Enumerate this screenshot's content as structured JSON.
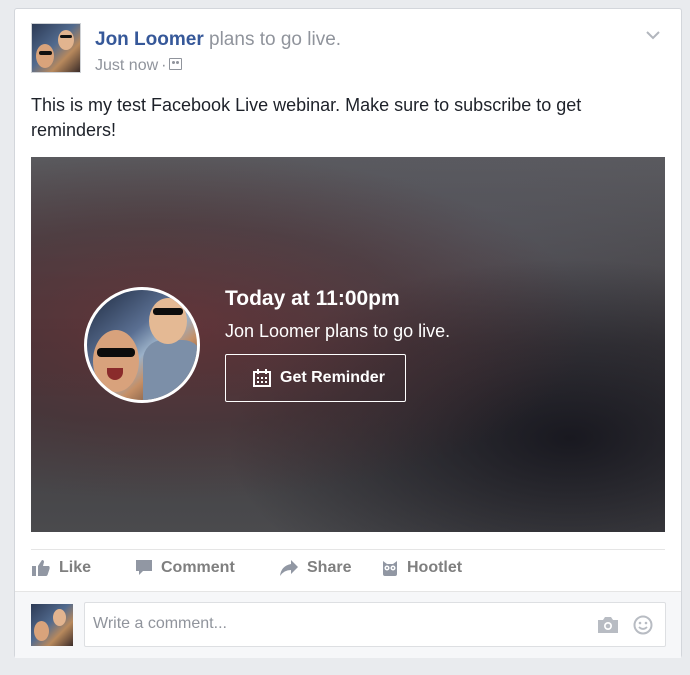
{
  "post": {
    "author": "Jon Loomer",
    "action": "plans to go live.",
    "timestamp": "Just now",
    "separator": "·",
    "audience_icon": "custom-audience-icon",
    "text": "This is my test Facebook Live webinar. Make sure to subscribe to get reminders!"
  },
  "live": {
    "title": "Today at 11:00pm",
    "subtitle": "Jon Loomer plans to go live.",
    "button_label": "Get Reminder"
  },
  "actions": [
    {
      "label": "Like",
      "icon": "thumbs-up-icon"
    },
    {
      "label": "Comment",
      "icon": "speech-bubble-icon"
    },
    {
      "label": "Share",
      "icon": "share-arrow-icon"
    },
    {
      "label": "Hootlet",
      "icon": "owl-icon"
    }
  ],
  "comment": {
    "placeholder": "Write a comment..."
  },
  "colors": {
    "link": "#365899",
    "muted": "#90949c",
    "action_text": "#7f7f7f"
  }
}
